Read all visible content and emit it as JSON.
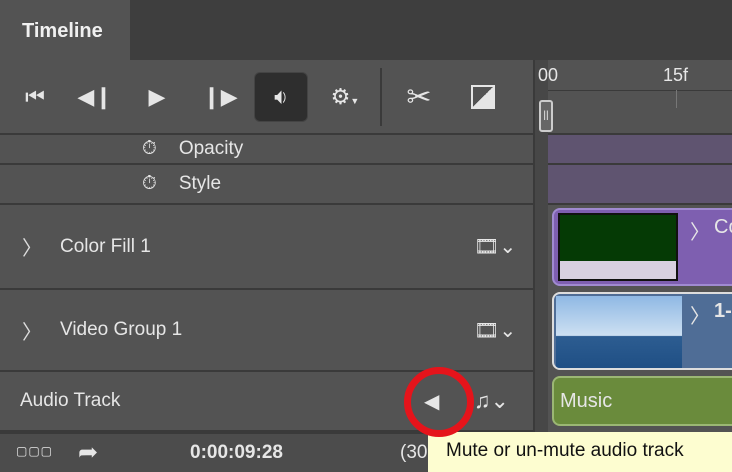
{
  "panel": {
    "tab_title": "Timeline"
  },
  "toolbar": {
    "first_frame": "go-to-first-frame",
    "prev_frame": "previous-frame",
    "play": "play",
    "next_frame": "next-frame",
    "audio": "toggle-audio",
    "settings": "settings",
    "split": "split-at-playhead",
    "transition": "transition"
  },
  "ruler": {
    "ticks": [
      "00",
      "15f"
    ]
  },
  "layers": [
    {
      "label": "Opacity",
      "type": "property"
    },
    {
      "label": "Style",
      "type": "property"
    },
    {
      "label": "Color Fill 1",
      "type": "video"
    },
    {
      "label": "Video Group 1",
      "type": "video"
    },
    {
      "label": "Audio Track",
      "type": "audio"
    }
  ],
  "clips": {
    "color_fill": "Co",
    "video_group": "1-",
    "audio": "Music"
  },
  "footer": {
    "timecode": "0:00:09:28",
    "fps": "(30"
  },
  "tooltip": "Mute or un-mute audio track",
  "colors": {
    "purple_clip": "#7e5fb0",
    "blue_clip": "#4f6d96",
    "green_clip": "#6a8b3c",
    "highlight": "#e5141b"
  }
}
